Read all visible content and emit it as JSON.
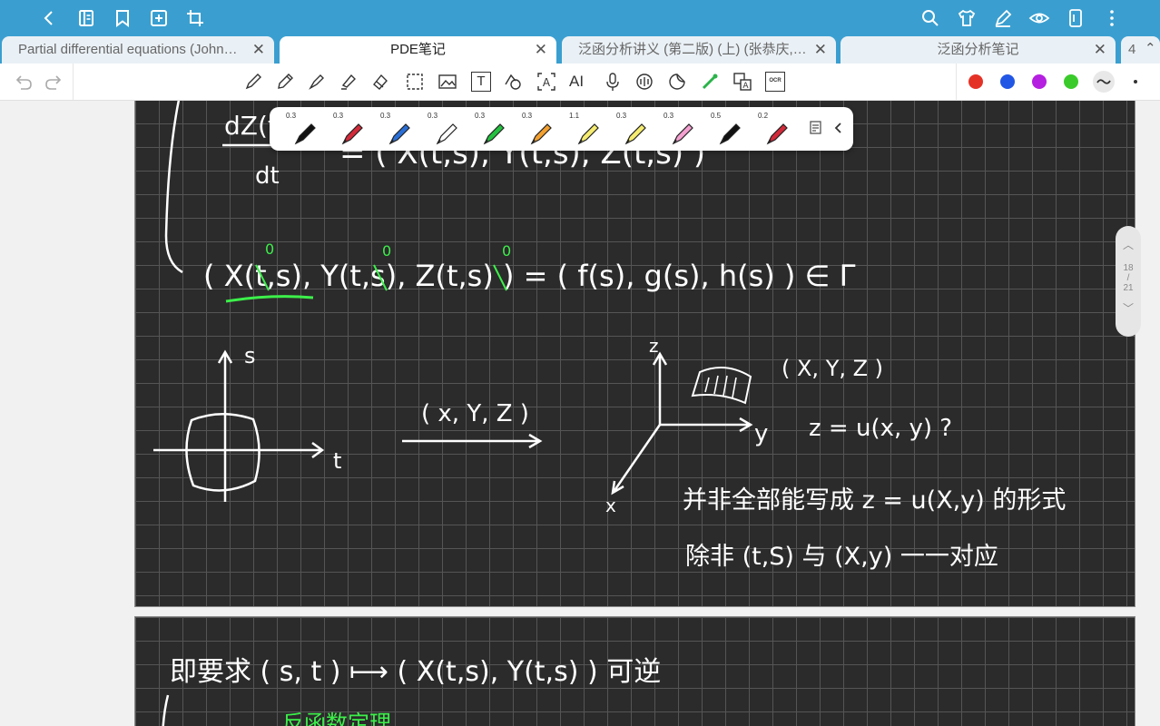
{
  "topbar": {
    "left_icons": [
      "back-icon",
      "book-icon",
      "bookmark-icon",
      "add-page-icon",
      "crop-icon"
    ],
    "right_icons": [
      "search-icon",
      "shirt-icon",
      "pen-mode-icon",
      "eye-icon",
      "phone-icon",
      "more-icon"
    ]
  },
  "tabs": [
    {
      "title": "Partial differential equations (John…",
      "active": false
    },
    {
      "title": "PDE笔记",
      "active": true
    },
    {
      "title": "泛函分析讲义 (第二版) (上) (张恭庆,…",
      "active": false
    },
    {
      "title": "泛函分析笔记",
      "active": false
    }
  ],
  "tab_overflow": {
    "count": "4"
  },
  "toolbar": {
    "tools": [
      "pen-icon",
      "pencil-icon",
      "fountain-pen-icon",
      "highlighter-icon",
      "eraser-icon",
      "lasso-icon",
      "image-icon",
      "text-icon",
      "shape-icon",
      "text-recognize-icon",
      "ai-icon",
      "mic-icon",
      "audio-icon",
      "sticker-icon",
      "laser-icon",
      "translate-icon",
      "ocr-icon"
    ],
    "ai_label": "AI",
    "ocr_label": "OCR",
    "text_label": "T",
    "colors": [
      "#e53227",
      "#2257e5",
      "#b41fe0",
      "#3acb2b"
    ]
  },
  "pen_presets": [
    {
      "width": "0.3",
      "color": "#111111"
    },
    {
      "width": "0.3",
      "color": "#d22a3a"
    },
    {
      "width": "0.3",
      "color": "#2a6fd6"
    },
    {
      "width": "0.3",
      "color": "#ffffff"
    },
    {
      "width": "0.3",
      "color": "#24c040"
    },
    {
      "width": "0.3",
      "color": "#f2a030"
    },
    {
      "width": "1.1",
      "color": "#f5ec70"
    },
    {
      "width": "0.3",
      "color": "#f5ec70"
    },
    {
      "width": "0.3",
      "color": "#f4a0d0"
    },
    {
      "width": "0.5",
      "color": "#111111"
    },
    {
      "width": "0.2",
      "color": "#d22a3a"
    }
  ],
  "scroll": {
    "current": "18",
    "sep": "/",
    "total": "21"
  },
  "note": {
    "frac_num": "dZ(t",
    "frac_den": "dt",
    "frac_rhs": "= ( X(t,s), Y(t,s), Z(t,s) )",
    "init_eq": "( X(t,s), Y(t,s), Z(t,s) ) = ( f(s), g(s), h(s) ) ∈ Γ",
    "zero_mark": "0",
    "axis_s": "s",
    "axis_t": "t",
    "map_label": "( x, Y, Z )",
    "axis_z": "z",
    "axis_y": "y",
    "axis_x": "x",
    "point_label": "( X, Y, Z )",
    "question": "z = u(x, y) ?",
    "remark1": "并非全部能写成 z = u(X,y) 的形式",
    "remark2": "除非 (t,S) 与 (X,y) 一一对应",
    "p2_line": "即要求 ( s, t ) ⟼ ( X(t,s), Y(t,s) ) 可逆",
    "p2_green": "反函数定理"
  }
}
